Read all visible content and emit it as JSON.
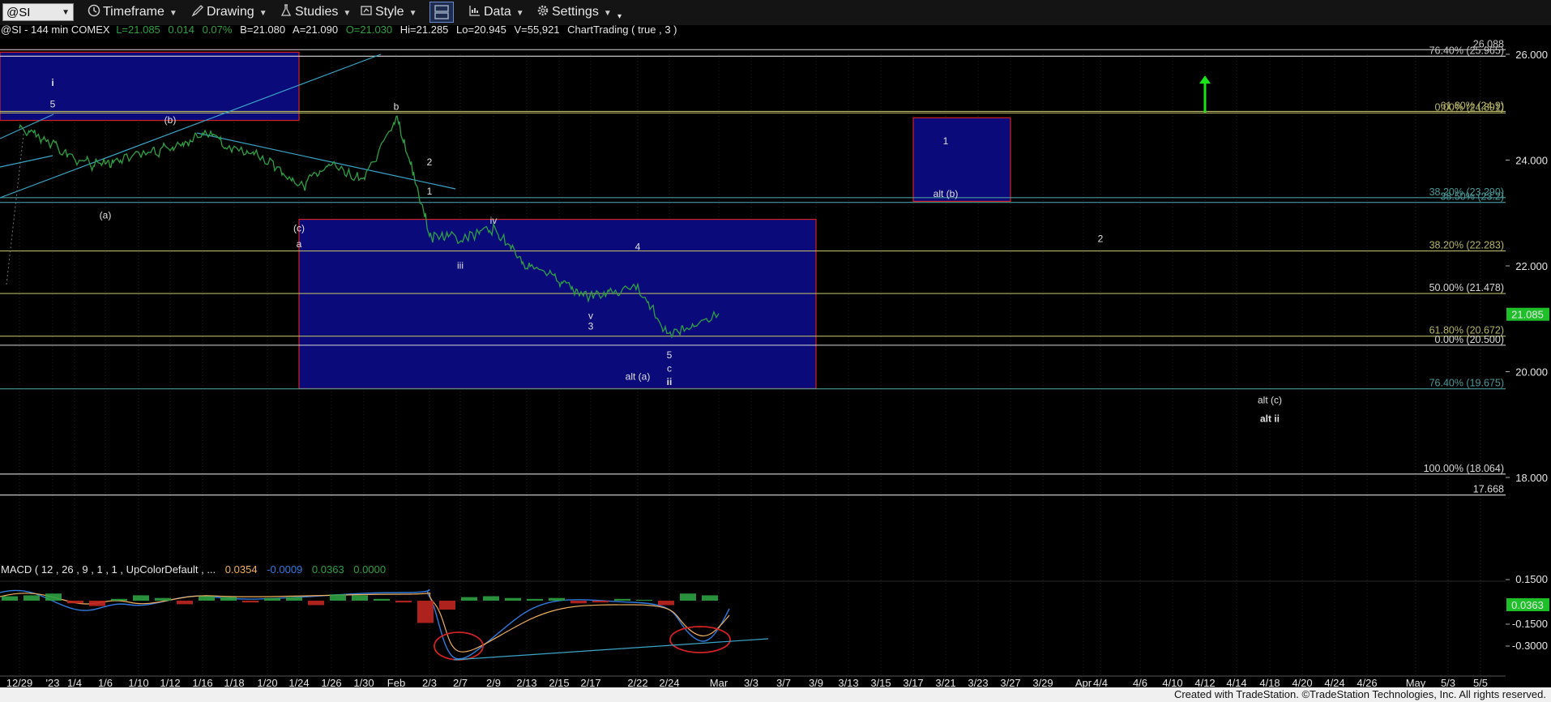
{
  "toolbar": {
    "symbol": "@SI",
    "timeframe_label": "Timeframe",
    "drawing_label": "Drawing",
    "studies_label": "Studies",
    "style_label": "Style",
    "data_label": "Data",
    "settings_label": "Settings",
    "icons": [
      "timeframe-clock-icon",
      "drawing-pen-icon",
      "studies-flask-icon",
      "style-icon",
      "layout-icon",
      "data-chart-icon",
      "settings-gear-icon"
    ]
  },
  "header": {
    "symbol_info": "@SI - 144 min  COMEX",
    "last": "L=21.085",
    "net_change": "0.014",
    "pct_change": "0.07%",
    "bid": "B=21.080",
    "ask": "A=21.090",
    "open": "O=21.030",
    "high": "Hi=21.285",
    "low": "Lo=20.945",
    "volume": "V=55,921",
    "study": "ChartTrading ( true , 3 )"
  },
  "macd_header": {
    "label": "MACD ( 12 , 26 , 9 , 1 , 1 , UpColorDefault , ...",
    "v1": "0.0354",
    "v2": "-0.0009",
    "v3": "0.0363",
    "v4": "0.0000"
  },
  "footer": {
    "credit": "Created with TradeStation. ©TradeStation Technologies, Inc. All rights reserved."
  },
  "colors": {
    "background": "#000000",
    "price": "#2ea043",
    "box_fill": "#0a0a7a",
    "box_border": "#d12222",
    "fib_olive": "#b5b565",
    "fib_teal": "#4a9a9a",
    "fib_white": "#d8d8d8",
    "arrow": "#19e619",
    "label_cyan": "#4fd2e0",
    "macd_up": "#2ea043",
    "macd_down": "#c0261f",
    "macd_line": "#2f7be0",
    "macd_signal": "#f0b060"
  },
  "chart_data": {
    "type": "candlestick",
    "title": "@SI - 144 min",
    "price_axis": {
      "ticks": [
        "26.000",
        "24.000",
        "22.000",
        "20.000",
        "18.000"
      ],
      "ylim": [
        16.0,
        26.6
      ]
    },
    "last_price_label": "21.085",
    "x_ticks": [
      "12/29",
      "'23",
      "1/4",
      "1/6",
      "1/10",
      "1/12",
      "1/16",
      "1/18",
      "1/20",
      "1/24",
      "1/26",
      "1/30",
      "Feb",
      "2/3",
      "2/7",
      "2/9",
      "2/13",
      "2/15",
      "2/17",
      "2/22",
      "2/24",
      "Mar",
      "3/3",
      "3/7",
      "3/9",
      "3/13",
      "3/15",
      "3/17",
      "3/21",
      "3/23",
      "3/27",
      "3/29",
      "Apr",
      "4/4",
      "4/6",
      "4/10",
      "4/12",
      "4/14",
      "4/18",
      "4/20",
      "4/24",
      "4/26",
      "May",
      "5/3",
      "5/5"
    ],
    "price_series": [
      {
        "x": "12/29",
        "y": 24.6
      },
      {
        "x": "'23",
        "y": 24.3
      },
      {
        "x": "1/4",
        "y": 24.0
      },
      {
        "x": "1/6",
        "y": 23.9
      },
      {
        "x": "1/10",
        "y": 24.1
      },
      {
        "x": "1/12",
        "y": 24.2
      },
      {
        "x": "1/16",
        "y": 24.5
      },
      {
        "x": "1/18",
        "y": 24.2
      },
      {
        "x": "1/20",
        "y": 24.0
      },
      {
        "x": "1/24",
        "y": 23.5
      },
      {
        "x": "1/26",
        "y": 23.9
      },
      {
        "x": "1/30",
        "y": 23.6
      },
      {
        "x": "Feb",
        "y": 24.8
      },
      {
        "x": "2/3",
        "y": 22.6
      },
      {
        "x": "2/7",
        "y": 22.5
      },
      {
        "x": "2/9",
        "y": 22.7
      },
      {
        "x": "2/13",
        "y": 22.0
      },
      {
        "x": "2/15",
        "y": 21.7
      },
      {
        "x": "2/17",
        "y": 21.4
      },
      {
        "x": "2/22",
        "y": 21.6
      },
      {
        "x": "2/24",
        "y": 20.7
      },
      {
        "x": "Mar",
        "y": 21.1
      }
    ],
    "fib_levels": [
      {
        "label": "26.088",
        "value": 26.088,
        "color": "#c8c8c8",
        "linecolor": "#d8d8d8"
      },
      {
        "label": "76.40% (25.965)",
        "value": 25.965,
        "color": "#c8c8c8",
        "linecolor": "#d8d8d8"
      },
      {
        "label": "61.80% (24.9)",
        "value": 24.92,
        "color": "#b5b565",
        "linecolor": "#b5b565"
      },
      {
        "label": "0.00% (24.891)",
        "value": 24.891,
        "color": "#b5b565",
        "linecolor": "#b5b565"
      },
      {
        "label": "38.20% (23.290)",
        "value": 23.29,
        "color": "#4a9a9a",
        "linecolor": "#4a9a9a"
      },
      {
        "label": "38.50% (23.2)",
        "value": 23.2,
        "color": "#4a9a9a",
        "linecolor": "#4a9a9a"
      },
      {
        "label": "38.20% (22.283)",
        "value": 22.283,
        "color": "#b5b565",
        "linecolor": "#b5b565"
      },
      {
        "label": "50.00% (21.478)",
        "value": 21.478,
        "color": "#d8d8d8",
        "linecolor": "#b5b565"
      },
      {
        "label": "61.80% (20.672)",
        "value": 20.672,
        "color": "#b5b565",
        "linecolor": "#b5b565"
      },
      {
        "label": "0.00% (20.500)",
        "value": 20.5,
        "color": "#d8d8d8",
        "linecolor": "#d8d8d8"
      },
      {
        "label": "76.40% (19.675)",
        "value": 19.675,
        "color": "#4a9a9a",
        "linecolor": "#4a9a9a"
      },
      {
        "label": "100.00% (18.064)",
        "value": 18.064,
        "color": "#d8d8d8",
        "linecolor": "#d8d8d8"
      },
      {
        "label": "17.668",
        "value": 17.668,
        "color": "#d8d8d8",
        "linecolor": "#d8d8d8"
      }
    ],
    "boxes": [
      {
        "name": "box-top-left",
        "x0": "12/29",
        "x1": "1/24",
        "y0": 24.75,
        "y1": 26.04
      },
      {
        "name": "box-main-target",
        "x0": "1/24",
        "x1": "3/9",
        "y0": 19.68,
        "y1": 22.88
      },
      {
        "name": "box-alt-b",
        "x0": "3/17",
        "x1": "3/27",
        "y0": 23.22,
        "y1": 24.8
      }
    ],
    "wave_labels": [
      {
        "text": "i",
        "x": "'23",
        "y": 25.4,
        "color": "#e0e0e0",
        "bold": true
      },
      {
        "text": "5",
        "x": "'23",
        "y": 25.0
      },
      {
        "text": "(b)",
        "x": "1/12",
        "y": 24.7
      },
      {
        "text": "(a)",
        "x": "1/6",
        "y": 22.9
      },
      {
        "text": "(c)",
        "x": "1/24",
        "y": 22.65
      },
      {
        "text": "a",
        "x": "1/24",
        "y": 22.35
      },
      {
        "text": "b",
        "x": "Feb",
        "y": 24.95
      },
      {
        "text": "2",
        "x": "2/3",
        "y": 23.9
      },
      {
        "text": "1",
        "x": "2/3",
        "y": 23.35
      },
      {
        "text": "iv",
        "x": "2/9",
        "y": 22.8
      },
      {
        "text": "iii",
        "x": "2/7",
        "y": 21.95
      },
      {
        "text": "4",
        "x": "2/22",
        "y": 22.3
      },
      {
        "text": "v",
        "x": "2/17",
        "y": 21.0
      },
      {
        "text": "3",
        "x": "2/17",
        "y": 20.8
      },
      {
        "text": "5",
        "x": "2/24",
        "y": 20.25
      },
      {
        "text": "c",
        "x": "2/24",
        "y": 20.0
      },
      {
        "text": "ii",
        "x": "2/24",
        "y": 19.75,
        "bold": true
      },
      {
        "text": "alt (a)",
        "x": "2/22",
        "y": 19.85,
        "color": "#4fd2e0"
      },
      {
        "text": "1",
        "x": "3/21",
        "y": 24.3
      },
      {
        "text": "alt (b)",
        "x": "3/21",
        "y": 23.3,
        "color": "#4fd2e0"
      },
      {
        "text": "2",
        "x": "4/4",
        "y": 22.45
      },
      {
        "text": "alt (c)",
        "x": "4/18",
        "y": 19.4,
        "color": "#4fd2e0"
      },
      {
        "text": "alt ii",
        "x": "4/18",
        "y": 19.05,
        "color": "#4fd2e0",
        "bold": true
      }
    ],
    "up_arrow": {
      "x": "4/12",
      "y_from": 24.9,
      "y_to": 25.6
    },
    "macd": {
      "axis_ticks": [
        "0.1500",
        "-0.1500",
        "-0.3000"
      ],
      "value_label": "0.0363",
      "hist": [
        0.05,
        0.06,
        0.08,
        -0.03,
        -0.06,
        0.02,
        0.06,
        0.03,
        -0.04,
        0.05,
        0.04,
        -0.02,
        0.03,
        0.04,
        -0.05,
        0.07,
        0.06,
        0.02,
        -0.02,
        -0.25,
        -0.1,
        0.04,
        0.05,
        0.03,
        0.02,
        0.03,
        -0.03,
        -0.02,
        0.02,
        0.01,
        -0.05,
        0.08,
        0.06
      ]
    }
  }
}
